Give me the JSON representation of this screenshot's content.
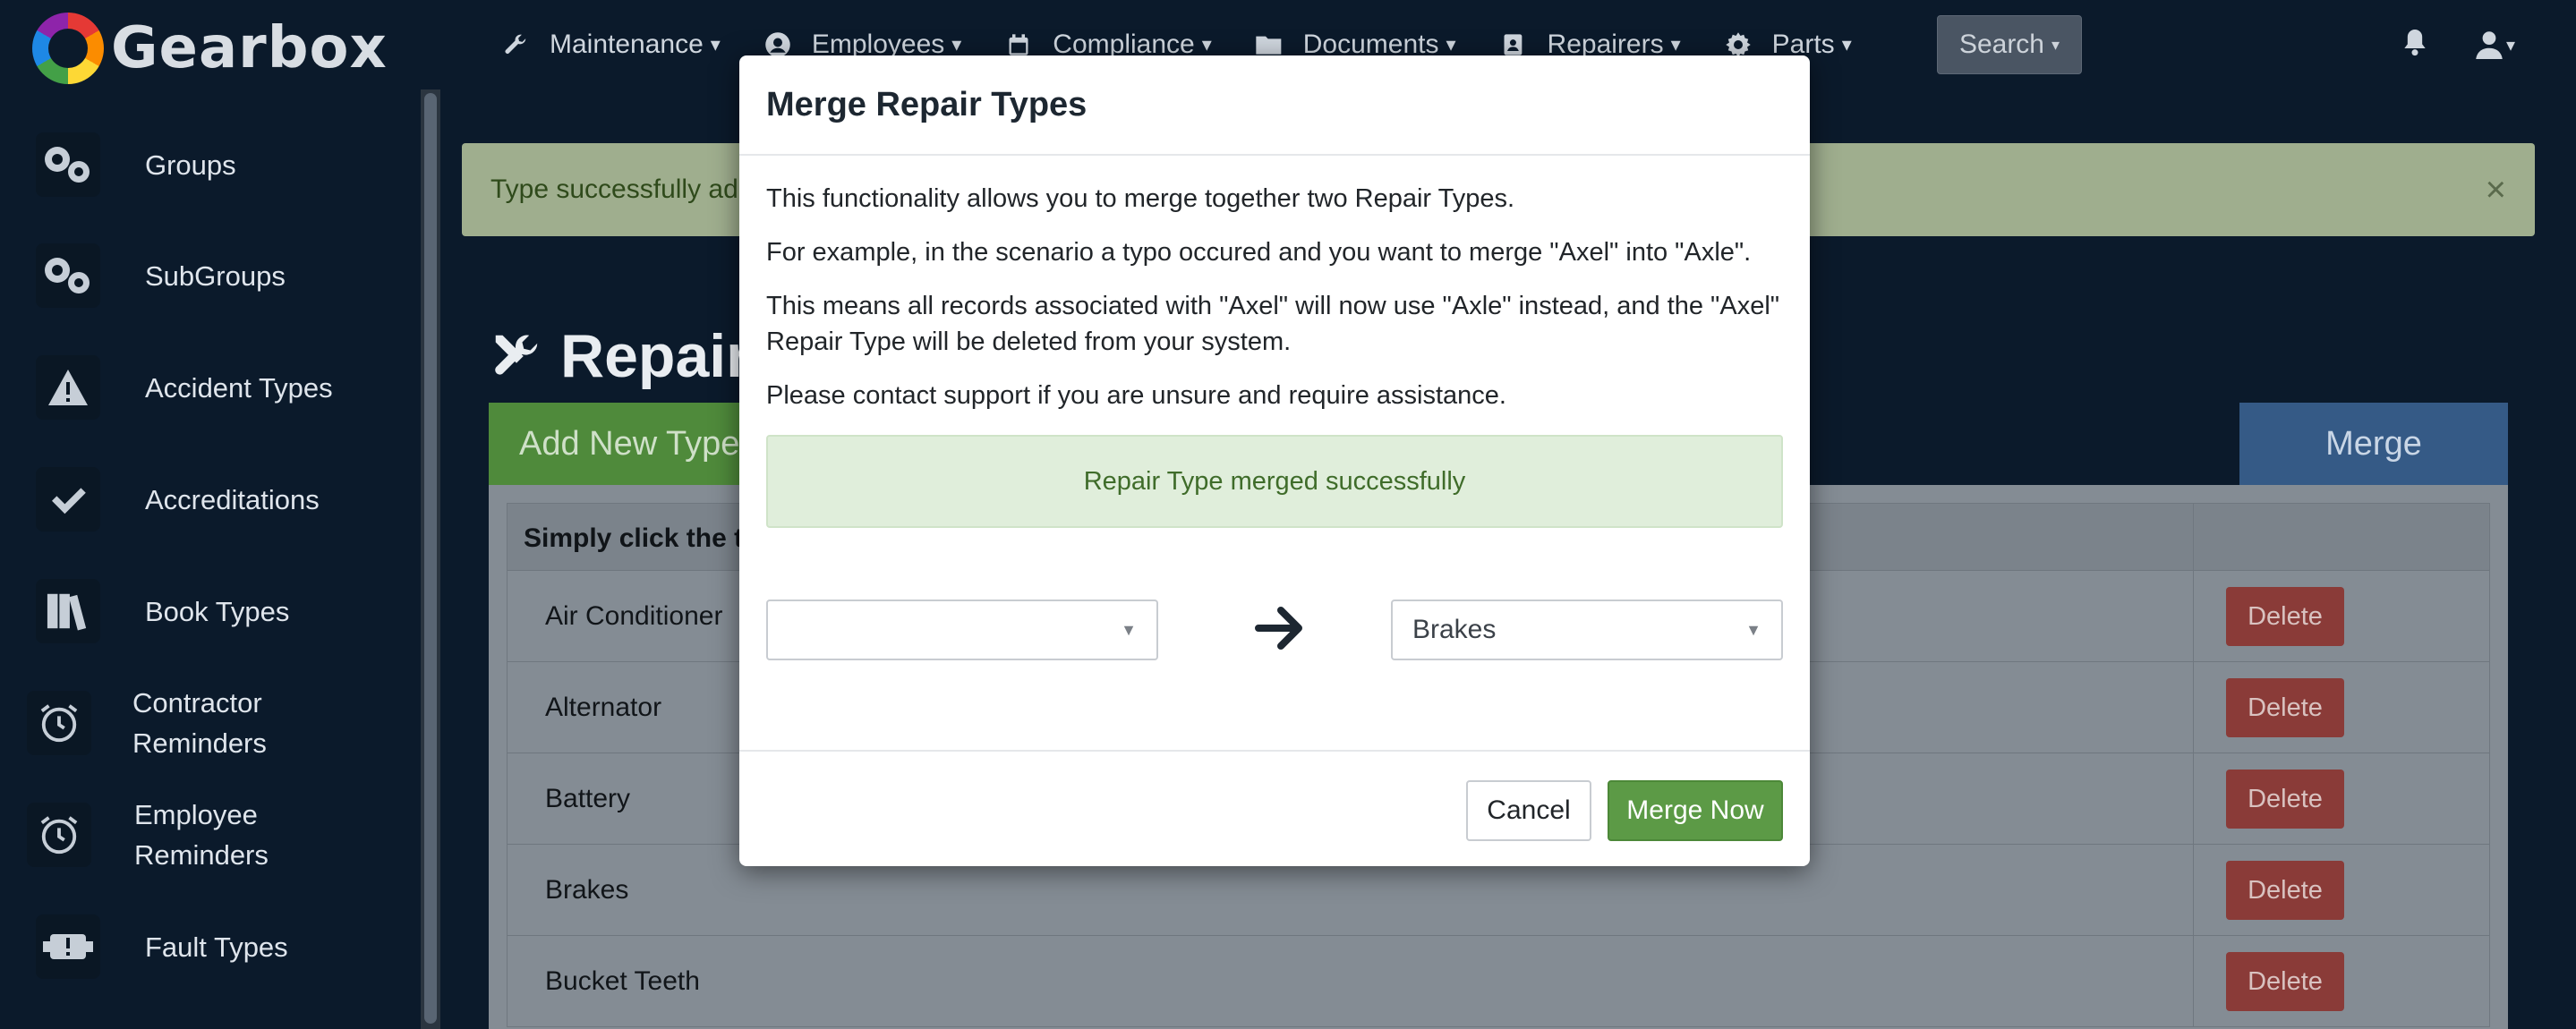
{
  "brand": {
    "name": "Gearbox"
  },
  "nav": {
    "items": [
      {
        "label": "Maintenance",
        "icon": "wrench-icon"
      },
      {
        "label": "Employees",
        "icon": "user-circle-icon"
      },
      {
        "label": "Compliance",
        "icon": "calendar-icon"
      },
      {
        "label": "Documents",
        "icon": "folder-icon"
      },
      {
        "label": "Repairers",
        "icon": "address-book-icon"
      },
      {
        "label": "Parts",
        "icon": "cog-icon"
      }
    ],
    "search_label": "Search"
  },
  "sidebar": {
    "items": [
      {
        "label": "Groups",
        "icon": "cogs-icon"
      },
      {
        "label": "SubGroups",
        "icon": "cogs-icon"
      },
      {
        "label": "Accident Types",
        "icon": "warning-icon"
      },
      {
        "label": "Accreditations",
        "icon": "check-icon"
      },
      {
        "label": "Book Types",
        "icon": "books-icon"
      },
      {
        "label_line1": "Contractor",
        "label_line2": "Reminders",
        "icon": "alarm-clock-icon"
      },
      {
        "label_line1": "Employee",
        "label_line2": "Reminders",
        "icon": "alarm-clock-icon"
      },
      {
        "label": "Fault Types",
        "icon": "fault-icon"
      }
    ]
  },
  "main": {
    "alert_text": "Type successfully adde",
    "alert_close": "×",
    "title": "Repair T",
    "add_type_label": "Add New Type",
    "merge_tab_label": "Merge",
    "table_header": "Simply click the ty",
    "rows": [
      {
        "name": "Air Conditioner",
        "action": "Delete"
      },
      {
        "name": "Alternator",
        "action": "Delete"
      },
      {
        "name": "Battery",
        "action": "Delete"
      },
      {
        "name": "Brakes",
        "action": "Delete"
      },
      {
        "name": "Bucket Teeth",
        "action": "Delete"
      }
    ]
  },
  "modal": {
    "title": "Merge Repair Types",
    "p1": "This functionality allows you to merge together two Repair Types.",
    "p2": "For example, in the scenario a typo occured and you want to merge \"Axel\" into \"Axle\".",
    "p3": "This means all records associated with \"Axel\" will now use \"Axle\" instead, and the \"Axel\" Repair Type will be deleted from your system.",
    "p4": "Please contact support if you are unsure and require assistance.",
    "success_message": "Repair Type merged successfully",
    "from_select_value": "",
    "to_select_value": "Brakes",
    "cancel_label": "Cancel",
    "merge_now_label": "Merge Now"
  },
  "colors": {
    "background": "#0b1a2b",
    "success_green": "#5c9a46",
    "delete_red": "#8a3b38",
    "merge_blue": "#355a86"
  }
}
